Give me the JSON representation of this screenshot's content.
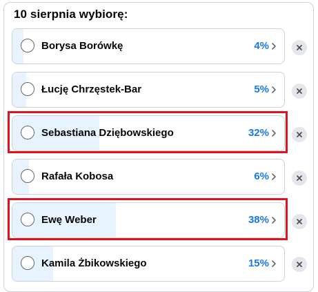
{
  "poll": {
    "title": "10 sierpnia wybiorę:",
    "options": [
      {
        "label": "Borysa Borówkę",
        "percent_text": "4%",
        "percent": 4
      },
      {
        "label": "Łucję Chrzęstek-Bar",
        "percent_text": "5%",
        "percent": 5
      },
      {
        "label": "Sebastiana Dziębowskiego",
        "percent_text": "32%",
        "percent": 32
      },
      {
        "label": "Rafała Kobosa",
        "percent_text": "6%",
        "percent": 6
      },
      {
        "label": "Ewę Weber",
        "percent_text": "38%",
        "percent": 38
      },
      {
        "label": "Kamila Żbikowskiego",
        "percent_text": "15%",
        "percent": 15
      }
    ]
  },
  "colors": {
    "accent": "#1877f2",
    "fill": "#e7f3ff",
    "highlight": "#e0121e",
    "remove_bg": "#e4e6eb"
  },
  "icons": {
    "radio": "radio-circle-icon",
    "chevron": "chevron-right-icon",
    "remove": "close-icon"
  }
}
